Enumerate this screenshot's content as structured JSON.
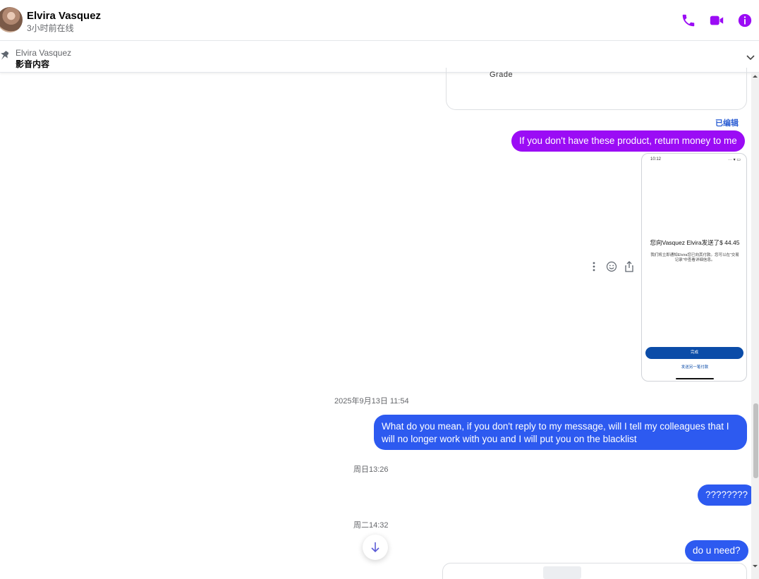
{
  "header": {
    "contact_name": "Elvira Vasquez",
    "status": "3小时前在线",
    "icons": [
      "phone-icon",
      "video-call-icon",
      "info-icon"
    ],
    "accent_color": "#9b0cf5"
  },
  "pinned": {
    "author": "Elvira Vasquez",
    "text": "影音内容"
  },
  "messages": {
    "card_grade_text": "Grade",
    "edited_label": "已编辑",
    "msg1": "If you don't have these product, return money to me",
    "screenshot": {
      "time": "10:12",
      "status": "··· ▾ ▭",
      "title": "您向Vasquez Elvira发送了$ 44.45",
      "description": "我们将立即通知Elvira您已向其付款。您可以在“交易记录”中查看详细信息。",
      "button": "完成",
      "link": "发送另一笔付款"
    },
    "timestamp1": "2025年9月13日 11:54",
    "msg2": "What do you mean, if you don't reply to my message, will I tell my colleagues that I will no longer work with you and I will put you on the blacklist",
    "timestamp2": "周日13:26",
    "msg3": "????????",
    "timestamp3": "周二14:32",
    "msg4": "do u need?"
  },
  "colors": {
    "purple_bubble": "#9b0cf5",
    "blue_bubble": "#2d5af0",
    "edited_label": "#2d5fd4"
  }
}
